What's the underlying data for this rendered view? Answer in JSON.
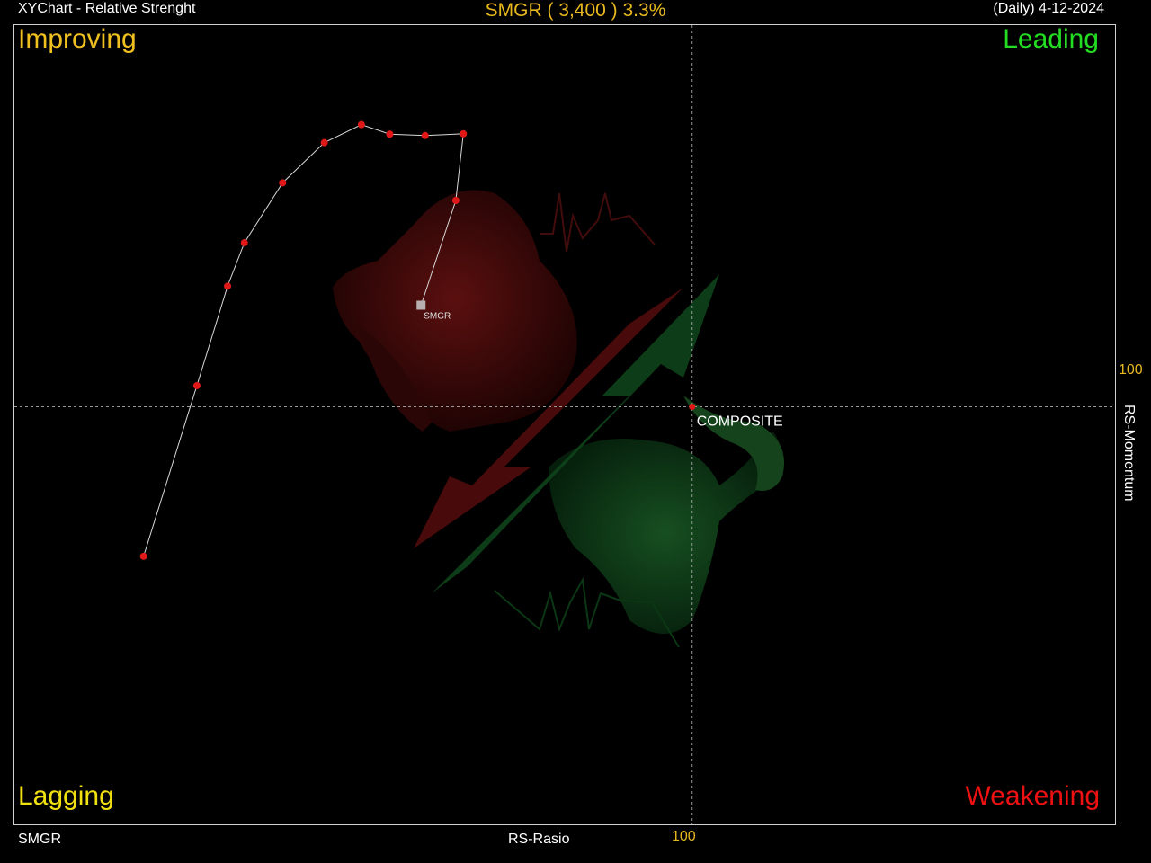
{
  "header": {
    "app_title": "XYChart - Relative Strenght",
    "symbol_summary": "SMGR ( 3,400 )  3.3%",
    "period_date": "(Daily) 4-12-2024"
  },
  "footer": {
    "symbol": "SMGR",
    "x_label": "RS-Rasio"
  },
  "colors": {
    "background": "#000000",
    "improving": "#f0c020",
    "leading": "#22dd22",
    "lagging": "#f0e010",
    "weakening": "#ee1111",
    "tick": "#e8b81f",
    "trail_point": "#e01818",
    "trail_line": "#d8d8d8"
  },
  "chart_data": {
    "type": "scatter",
    "title": "SMGR ( 3,400 )  3.3%",
    "xlabel": "RS-Rasio",
    "ylabel": "RS-Momentum",
    "x_tick": "100",
    "y_tick": "100",
    "x_center": 100,
    "y_center": 100,
    "xlim": [
      88.3,
      107.3
    ],
    "ylim": [
      88.16,
      110.82
    ],
    "quadrants": {
      "top_left": "Improving",
      "top_right": "Leading",
      "bottom_left": "Lagging",
      "bottom_right": "Weakening"
    },
    "grid": "center crosshair only",
    "reference_point": {
      "label": "COMPOSITE",
      "x": 100,
      "y": 100
    },
    "series": [
      {
        "name": "SMGR",
        "points": [
          {
            "x": 90.53,
            "y": 95.76
          },
          {
            "x": 91.45,
            "y": 100.6
          },
          {
            "x": 91.98,
            "y": 103.42
          },
          {
            "x": 92.27,
            "y": 104.65
          },
          {
            "x": 92.93,
            "y": 106.35
          },
          {
            "x": 93.65,
            "y": 107.49
          },
          {
            "x": 94.29,
            "y": 108.0
          },
          {
            "x": 94.78,
            "y": 107.73
          },
          {
            "x": 95.39,
            "y": 107.69
          },
          {
            "x": 96.05,
            "y": 107.74
          },
          {
            "x": 95.92,
            "y": 105.85
          },
          {
            "x": 95.32,
            "y": 102.88
          }
        ],
        "current_label": "SMGR"
      }
    ]
  }
}
